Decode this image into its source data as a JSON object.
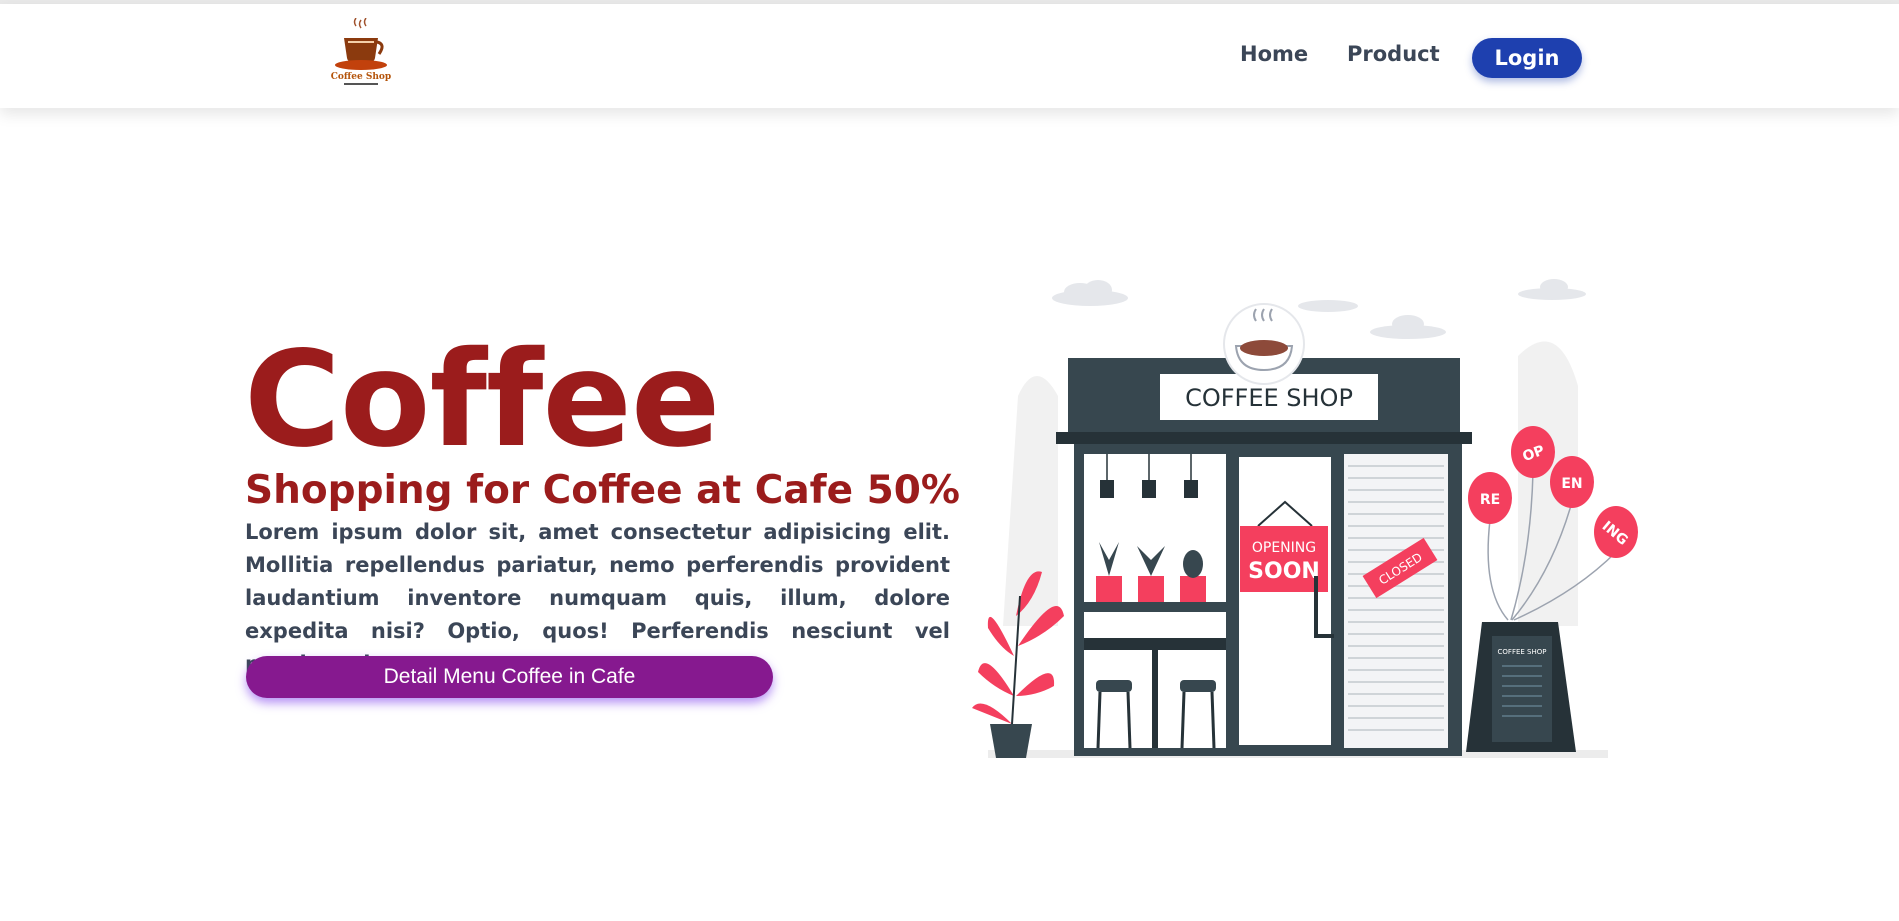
{
  "nav": {
    "logo_text": "Coffee Shop",
    "links": [
      {
        "label": "Home"
      },
      {
        "label": "Product"
      }
    ],
    "login_label": "Login"
  },
  "hero": {
    "title": "Coffee",
    "subtitle": "Shopping for Coffee at Cafe 50%",
    "description": "Lorem ipsum dolor sit, amet consectetur adipisicing elit. Mollitia repellendus pariatur, nemo perferendis provident laudantium inventore numquam quis, illum, dolore expedita nisi? Optio, quos! Perferendis nesciunt vel possimus iste earum.",
    "cta_label": "Detail Menu Coffee in Cafe"
  },
  "illustration": {
    "sign": "COFFEE SHOP",
    "opening_line1": "OPENING",
    "opening_line2": "SOON",
    "closed": "CLOSED",
    "balloons": [
      "RE",
      "OP",
      "EN",
      "ING"
    ],
    "board": "COFFEE SHOP"
  },
  "colors": {
    "brand_red": "#9b1c1c",
    "nav_text": "#3b4657",
    "login_bg": "#1e40af",
    "cta_bg": "#86198f",
    "accent_pink": "#f43f5e",
    "shop_dark": "#37474f"
  }
}
